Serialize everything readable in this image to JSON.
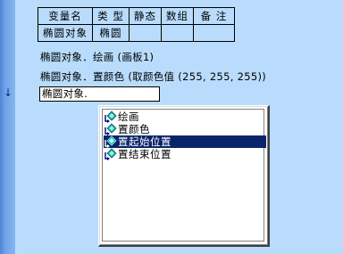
{
  "gutter": {
    "current_line_marker": "↓"
  },
  "var_table": {
    "headers": [
      "变量名",
      "类 型",
      "静态",
      "数组",
      "备 注"
    ],
    "rows": [
      [
        "椭圆对象",
        "椭圆",
        "",
        "",
        ""
      ]
    ]
  },
  "code": {
    "line1": "椭圆对象．绘画 (画板1)",
    "line2": "椭圆对象．置颜色 (取颜色值 (255, 255, 255))",
    "current_input": "椭圆对象."
  },
  "autocomplete": {
    "items": [
      {
        "label": "绘画",
        "icon": "method-icon",
        "selected": false
      },
      {
        "label": "置颜色",
        "icon": "method-icon",
        "selected": false
      },
      {
        "label": "置起始位置",
        "icon": "method-icon",
        "selected": true
      },
      {
        "label": "置结束位置",
        "icon": "method-icon",
        "selected": false
      }
    ]
  },
  "colors": {
    "background": "#b9dcfc",
    "gutter": "#6fa4ea",
    "selection": "#0a246a"
  }
}
